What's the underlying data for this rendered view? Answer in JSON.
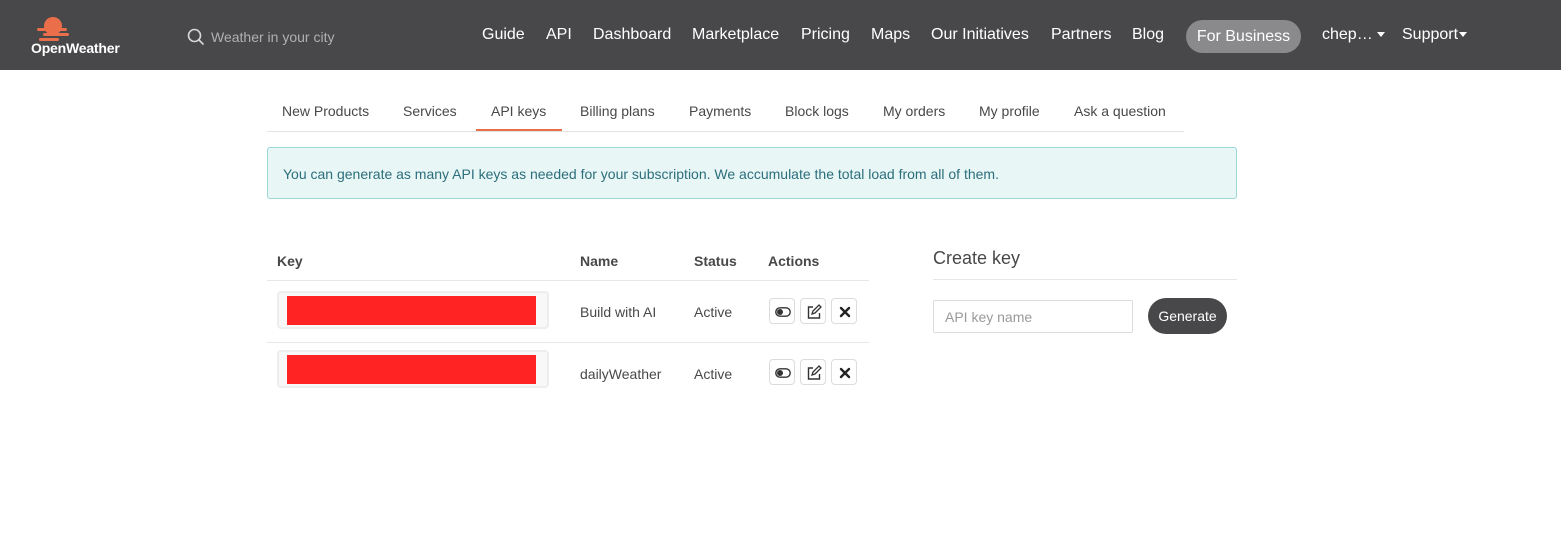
{
  "brand": {
    "name": "OpenWeather",
    "accent": "#eb6e4b",
    "nav_bg": "#48484a"
  },
  "search": {
    "placeholder": "Weather in your city"
  },
  "nav": {
    "items": [
      "Guide",
      "API",
      "Dashboard",
      "Marketplace",
      "Pricing",
      "Maps",
      "Our Initiatives",
      "Partners",
      "Blog"
    ],
    "business": "For Business",
    "user": "chep…",
    "support": "Support"
  },
  "tabs": {
    "items": [
      "New Products",
      "Services",
      "API keys",
      "Billing plans",
      "Payments",
      "Block logs",
      "My orders",
      "My profile",
      "Ask a question"
    ],
    "active": "API keys"
  },
  "alert": {
    "text": "You can generate as many API keys as needed for your subscription. We accumulate the total load from all of them."
  },
  "table": {
    "headers": {
      "key": "Key",
      "name": "Name",
      "status": "Status",
      "actions": "Actions"
    },
    "rows": [
      {
        "name": "Build with AI",
        "status": "Active"
      },
      {
        "name": "dailyWeather",
        "status": "Active"
      }
    ],
    "action_icons": [
      "toggle-icon",
      "edit-icon",
      "close-icon"
    ]
  },
  "create": {
    "title": "Create key",
    "placeholder": "API key name",
    "button": "Generate"
  }
}
